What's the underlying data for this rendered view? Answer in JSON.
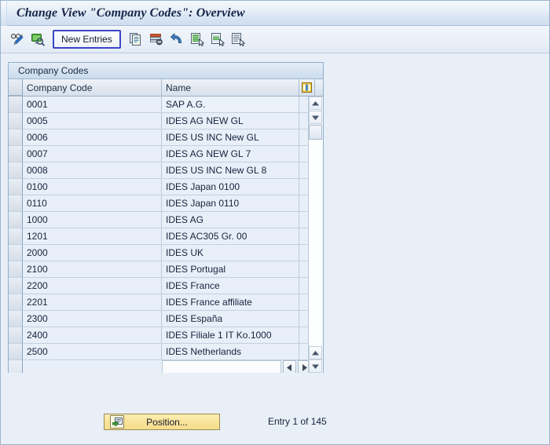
{
  "window": {
    "title": "Change View \"Company Codes\": Overview"
  },
  "toolbar": {
    "icons": [
      {
        "name": "display-change-icon",
        "title": "Display/Change"
      },
      {
        "name": "check-entries-icon",
        "title": "Check Entries"
      }
    ],
    "new_entries_label": "New Entries",
    "action_icons": [
      {
        "name": "copy-as-icon",
        "title": "Copy As..."
      },
      {
        "name": "delete-icon",
        "title": "Delete"
      },
      {
        "name": "undo-icon",
        "title": "Undo Change"
      },
      {
        "name": "select-all-icon",
        "title": "Select All"
      },
      {
        "name": "select-block-icon",
        "title": "Select Block"
      },
      {
        "name": "deselect-all-icon",
        "title": "Deselect All"
      }
    ]
  },
  "table": {
    "caption": "Company Codes",
    "config_icon": "table-settings-icon",
    "columns": [
      "Company Code",
      "Name"
    ],
    "rows": [
      {
        "code": "0001",
        "name": "SAP A.G."
      },
      {
        "code": "0005",
        "name": "IDES AG NEW GL"
      },
      {
        "code": "0006",
        "name": "IDES US INC New GL"
      },
      {
        "code": "0007",
        "name": "IDES AG NEW GL 7"
      },
      {
        "code": "0008",
        "name": "IDES US INC New GL 8"
      },
      {
        "code": "0100",
        "name": "IDES Japan 0100"
      },
      {
        "code": "0110",
        "name": "IDES Japan 0110"
      },
      {
        "code": "1000",
        "name": "IDES AG"
      },
      {
        "code": "1201",
        "name": "IDES AC305 Gr. 00"
      },
      {
        "code": "2000",
        "name": "IDES UK"
      },
      {
        "code": "2100",
        "name": "IDES Portugal"
      },
      {
        "code": "2200",
        "name": "IDES France"
      },
      {
        "code": "2201",
        "name": "IDES France affiliate"
      },
      {
        "code": "2300",
        "name": "IDES España"
      },
      {
        "code": "2400",
        "name": "IDES Filiale 1 IT Ko.1000"
      },
      {
        "code": "2500",
        "name": "IDES Netherlands"
      }
    ],
    "hscroll_value": ""
  },
  "footer": {
    "position_button_label": "Position...",
    "position_button_icon": "position-icon",
    "entry_counter": "Entry 1 of 145"
  },
  "colors": {
    "accent_focus_border": "#3b46c8",
    "cell_focus_marker": "#d12b2b",
    "button_yellow": "#f9e49a",
    "window_background": "#e8eef7"
  }
}
